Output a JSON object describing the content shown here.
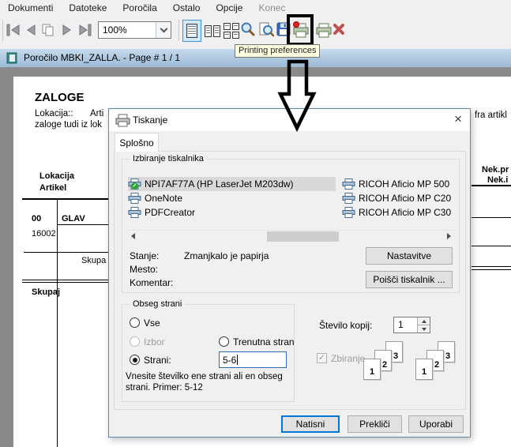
{
  "menubar": {
    "items": [
      "Dokumenti",
      "Datoteke",
      "Poročila",
      "Ostalo",
      "Opcije",
      "Konec"
    ]
  },
  "toolbar": {
    "zoom_value": "100%"
  },
  "tooltip": "Printing preferences",
  "report": {
    "window_title": "Poročilo MBKI_ZALLA. - Page # 1 / 1",
    "heading": "ZALOGE",
    "intro_label": "Lokacija::",
    "intro_label2": "Arti",
    "intro_line2": "zaloge tudi iz lok",
    "intro_right_fragment": "fra artikl",
    "col_lokacija": "Lokacija",
    "col_artikel": "Artikel",
    "col_nek_pr": "Nek.pr",
    "col_nek_i": "Nek.i",
    "group_code": "00",
    "group_name": "GLAV",
    "item_code": "16002",
    "subtotal_label": "Skupa",
    "total_label": "Skupaj"
  },
  "dialog": {
    "title": "Tiskanje",
    "tab": "Splošno",
    "printer_group_label": "Izbiranje tiskalnika",
    "printers_left": [
      "NPI7AF77A (HP LaserJet M203dw)",
      "OneNote",
      "PDFCreator"
    ],
    "printers_right": [
      "RICOH Aficio MP 500",
      "RICOH Aficio MP C20",
      "RICOH Aficio MP C30"
    ],
    "status_label": "Stanje:",
    "status_value": "Zmanjkalo je papirja",
    "location_label": "Mesto:",
    "comment_label": "Komentar:",
    "preferences_button": "Nastavitve",
    "find_printer_button": "Poišči tiskalnik ...",
    "range_group_label": "Obseg strani",
    "radio_all": "Vse",
    "radio_selection": "Izbor",
    "radio_current": "Trenutna stran",
    "radio_pages": "Strani:",
    "pages_value": "5-6",
    "range_hint_line1": "Vnesite številko ene strani ali en obseg",
    "range_hint_line2": "strani. Primer: 5-12",
    "copies_label": "Število kopij:",
    "copies_value": "1",
    "collate_label": "Zbiranje",
    "collate_numbers": [
      "1",
      "2",
      "3"
    ],
    "print_button": "Natisni",
    "cancel_button": "Prekliči",
    "apply_button": "Uporabi"
  },
  "icons": {
    "close": "×",
    "check": "✓"
  },
  "colors": {
    "accent_blue": "#0078d7",
    "selection_gray": "#d9d9d9",
    "titlebar_blue": "#b7cfe5",
    "report_background": "#8a8a8a",
    "tooltip_bg": "#ffffe1",
    "annotation_black": "#000000",
    "red_x": "#c0514e",
    "default_printer_green": "#2fa436"
  }
}
